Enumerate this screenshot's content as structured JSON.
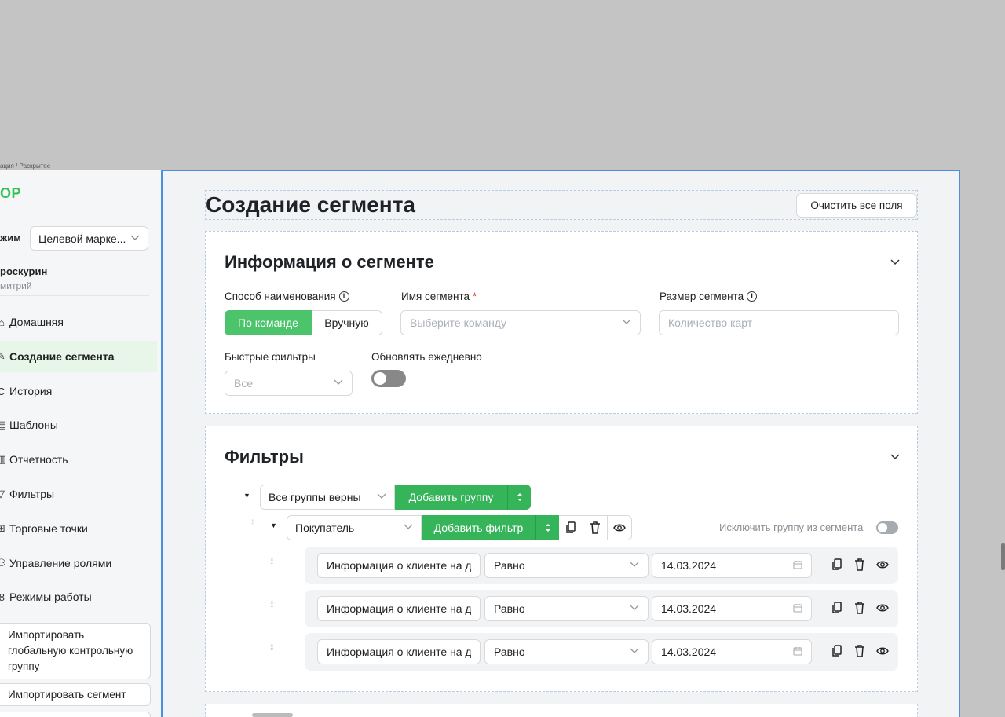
{
  "breadcrumb": "ация / Раскрытое",
  "sidebar": {
    "logo": "OP",
    "mode_label": "жим",
    "mode_value": "Целевой марке...",
    "user_name": "роскурин",
    "user_sub": "митрий",
    "items": [
      {
        "label": "Домашняя",
        "icon": "home-icon",
        "glyph": "⌂"
      },
      {
        "label": "Создание сегмента",
        "icon": "create-icon",
        "glyph": "✎"
      },
      {
        "label": "История",
        "icon": "history-icon",
        "glyph": "C"
      },
      {
        "label": "Шаблоны",
        "icon": "templates-icon",
        "glyph": "▤"
      },
      {
        "label": "Отчетность",
        "icon": "reports-icon",
        "glyph": "▥"
      },
      {
        "label": "Фильтры",
        "icon": "filter-icon",
        "glyph": "▽"
      },
      {
        "label": "Торговые точки",
        "icon": "store-icon",
        "glyph": "⊞"
      },
      {
        "label": "Управление ролями",
        "icon": "roles-icon",
        "glyph": "⚇"
      },
      {
        "label": "Режимы работы",
        "icon": "modes-icon",
        "glyph": "8"
      }
    ],
    "import_global": "Импортировать глобальную контрольную группу",
    "import_segment": "Импортировать сегмент"
  },
  "header": {
    "title": "Создание сегмента",
    "clear_button": "Очистить все поля"
  },
  "info_card": {
    "title": "Информация о сегменте",
    "naming_label": "Способ наименования",
    "naming_options": [
      "По команде",
      "Вручную"
    ],
    "name_label": "Имя сегмента",
    "name_required": "*",
    "name_placeholder": "Выберите команду",
    "size_label": "Размер сегмента",
    "size_placeholder": "Количество карт",
    "quick_filters_label": "Быстрые фильтры",
    "quick_filters_value": "Все",
    "daily_label": "Обновлять ежедневно",
    "daily_on": false
  },
  "filters_card": {
    "title": "Фильтры",
    "groups_select": "Все группы верны",
    "add_group": "Добавить группу",
    "entity_select": "Покупатель",
    "add_filter": "Добавить фильтр",
    "exclude_label": "Исключить группу из сегмента",
    "exclude_on": false,
    "rows": [
      {
        "field": "Информация о клиенте на да",
        "op": "Равно",
        "date": "14.03.2024"
      },
      {
        "field": "Информация о клиенте на да",
        "op": "Равно",
        "date": "14.03.2024"
      },
      {
        "field": "Информация о клиенте на да",
        "op": "Равно",
        "date": "14.03.2024"
      }
    ]
  },
  "colors": {
    "accent": "#35b45a",
    "accent_light": "#4cc46c",
    "selection_border": "#4a90e2",
    "background": "#c4c4c4"
  }
}
